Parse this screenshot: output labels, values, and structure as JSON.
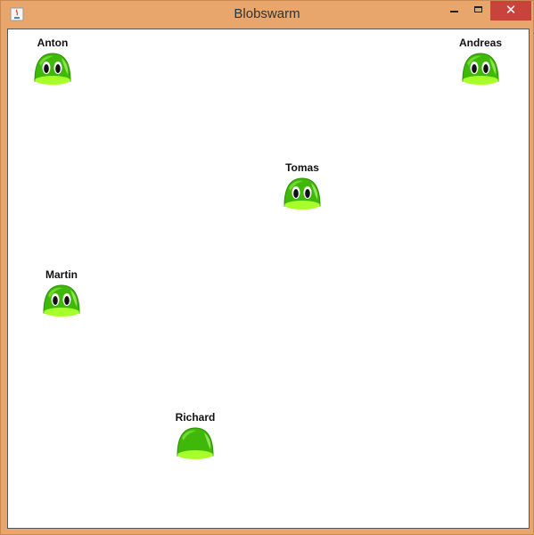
{
  "window": {
    "title": "Blobswarm",
    "app_icon": "java-icon",
    "controls": {
      "minimize": "minimize-icon",
      "maximize": "maximize-icon",
      "close_glyph": "✕"
    }
  },
  "blobs": [
    {
      "name": "Anton",
      "eyes": true
    },
    {
      "name": "Andreas",
      "eyes": true
    },
    {
      "name": "Tomas",
      "eyes": true
    },
    {
      "name": "Martin",
      "eyes": true
    },
    {
      "name": "Richard",
      "eyes": false
    }
  ],
  "colors": {
    "frame": "#e8a66c",
    "blob_green": "#3fb80a",
    "blob_belly": "#a6ff2a",
    "close_button": "#c8433b"
  }
}
